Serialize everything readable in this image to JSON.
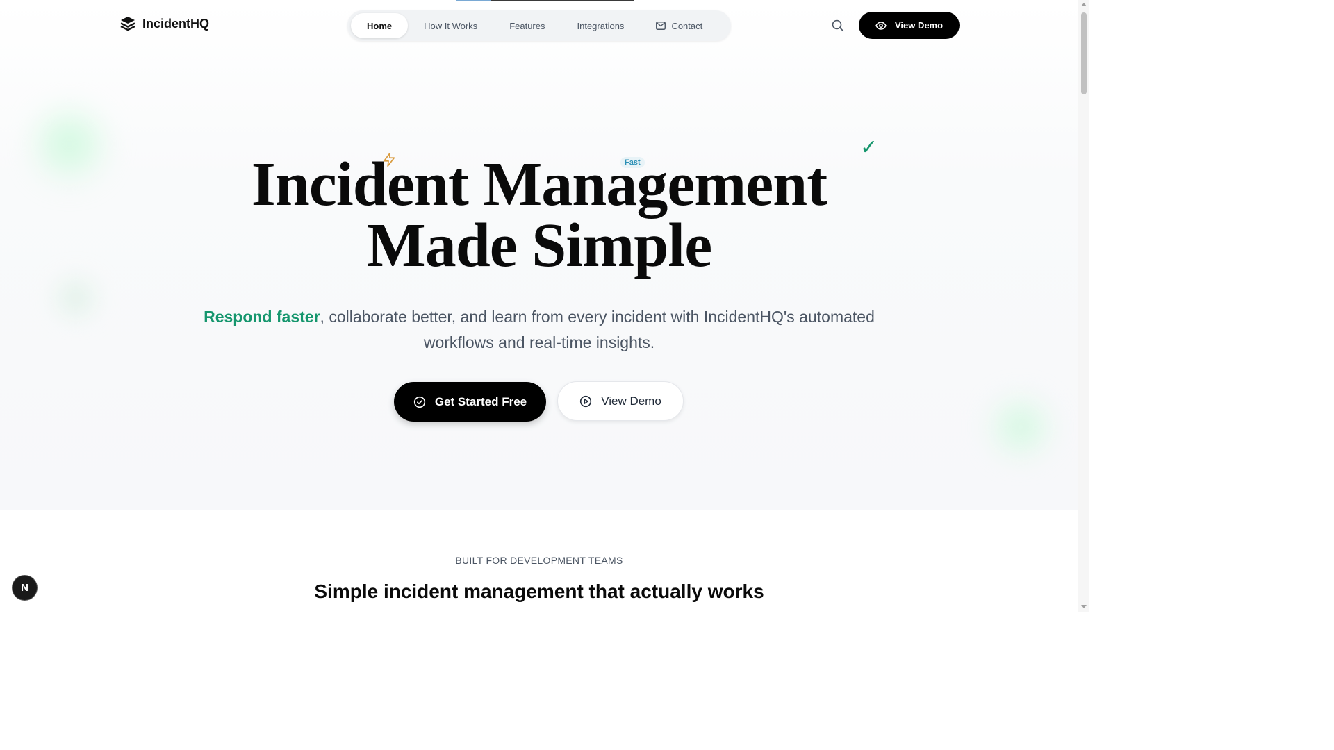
{
  "brand": {
    "name": "IncidentHQ",
    "icon": "layers-icon"
  },
  "nav": {
    "items": [
      {
        "label": "Home",
        "active": true
      },
      {
        "label": "How It Works",
        "active": false
      },
      {
        "label": "Features",
        "active": false
      },
      {
        "label": "Integrations",
        "active": false
      },
      {
        "label": "Contact",
        "active": false,
        "icon": "mail-icon"
      }
    ]
  },
  "header": {
    "search_icon": "search-icon",
    "demo_label": "View Demo",
    "demo_icon": "eye-icon"
  },
  "hero": {
    "badge_fast": "Fast",
    "check_mark": "✓",
    "title_line1": "Incident Management",
    "title_line2": "Made Simple",
    "subtitle_highlight": "Respond faster",
    "subtitle_rest": ", collaborate better, and learn from every incident with IncidentHQ's automated workflows and real-time insights.",
    "primary_cta": "Get Started Free",
    "secondary_cta": "View Demo"
  },
  "section": {
    "eyebrow": "BUILT FOR DEVELOPMENT TEAMS",
    "title": "Simple incident management that actually works"
  },
  "dev_badge": "N",
  "colors": {
    "accent": "#15966d",
    "fast_badge": "#2a8fb5",
    "primary": "#000000"
  }
}
